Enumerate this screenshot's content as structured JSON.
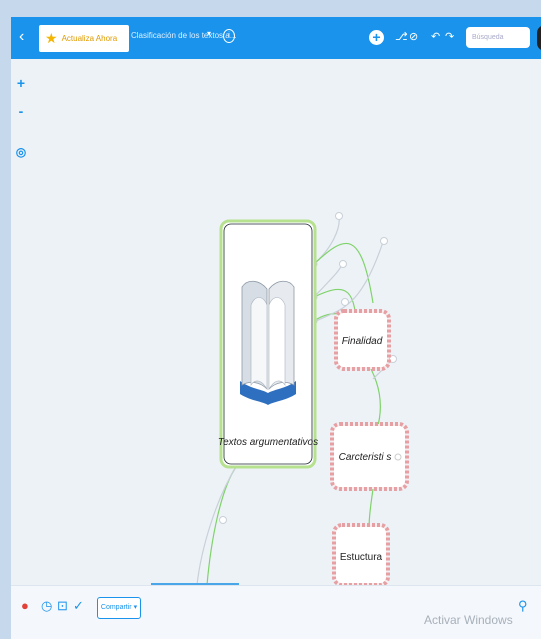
{
  "topbar": {
    "back_icon": "chevron-left-icon",
    "upgrade_label": "Actualiza Ahora",
    "doc_title": "Clasificación de los textos a...",
    "info_label": "i",
    "add_icon": "+",
    "search_placeholder": "Búsqueda",
    "colors": {
      "bar": "#1a93ec",
      "upgrade_text": "#e09b00"
    }
  },
  "canvas": {
    "zoom_in": "+",
    "zoom_out": "-",
    "center": "◎",
    "central_node": {
      "label": "Textos argumentativos",
      "icon": "open-book-icon"
    },
    "nodes": [
      {
        "label": "Finalidad"
      },
      {
        "label": "Carcteristi  s"
      },
      {
        "label": "Estuctura"
      }
    ],
    "colors": {
      "node_border": "#e6a0a4",
      "node_fill": "#fbecec",
      "link": "#7fd36a",
      "central_border": "#b6e28f"
    }
  },
  "bottombar": {
    "share_label": "Compartir",
    "watermark": "Activar Windows"
  }
}
